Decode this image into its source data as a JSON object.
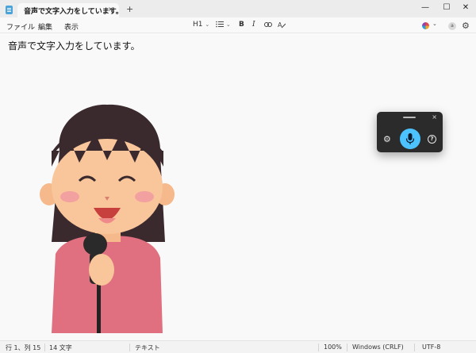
{
  "tab": {
    "title": "音声で文字入力をしています。",
    "close": "×",
    "new_tab": "+"
  },
  "window_controls": {
    "minimize": "—",
    "maximize": "☐",
    "close": "✕"
  },
  "menu": {
    "items": [
      "ファイル",
      "編集",
      "表示"
    ]
  },
  "toolbar": {
    "heading": "H1",
    "bold": "B",
    "italic": "I",
    "account_initial": "a"
  },
  "document": {
    "text": "音声で文字入力をしています。"
  },
  "voice_typing": {
    "close": "×",
    "help": "?"
  },
  "status": {
    "position": "行 1、列 15",
    "char_count": "14 文字",
    "format": "テキスト",
    "zoom": "100%",
    "line_ending": "Windows (CRLF)",
    "encoding": "UTF-8"
  },
  "colors": {
    "accent": "#4cc2ff",
    "panel": "#2b2b2b",
    "background": "#f9f9f9"
  }
}
